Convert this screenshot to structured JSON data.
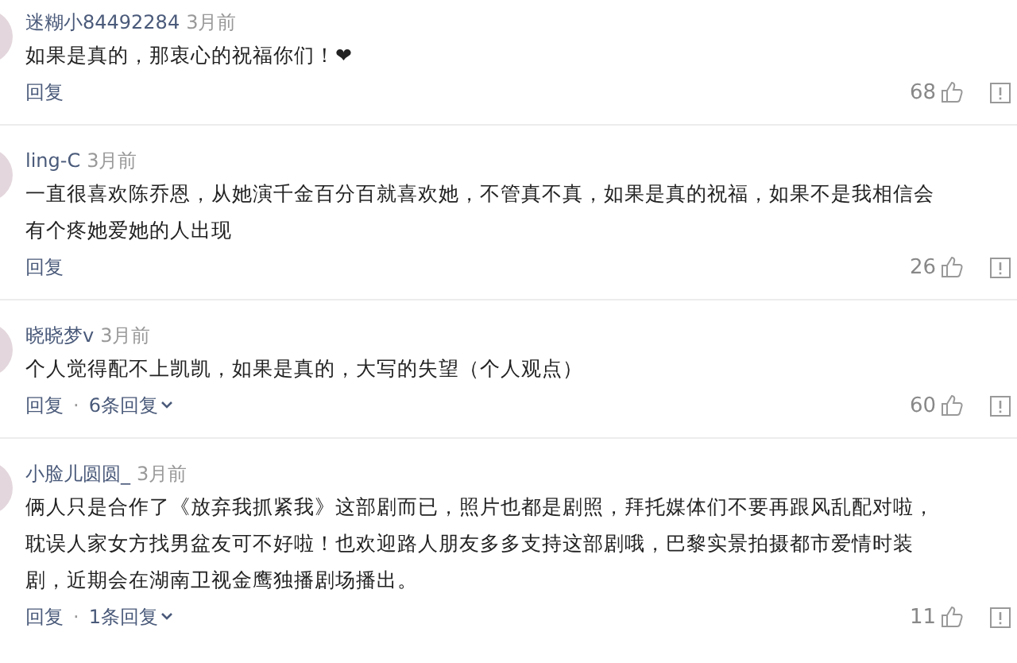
{
  "comments": [
    {
      "user": "迷糊小84492284",
      "time": "3月前",
      "lines": [
        "如果是真的，那衷心的祝福你们！❤"
      ],
      "reply": "回复",
      "likes": "68"
    },
    {
      "user": "ling-C",
      "time": "3月前",
      "lines": [
        "一直很喜欢陈乔恩，从她演千金百分百就喜欢她，不管真不真，如果是真的祝福，如果不是我相信会",
        "有个疼她爱她的人出现"
      ],
      "reply": "回复",
      "likes": "26"
    },
    {
      "user": "晓晓梦v",
      "time": "3月前",
      "lines": [
        "个人觉得配不上凯凯，如果是真的，大写的失望（个人观点）"
      ],
      "reply": "回复",
      "sep": "·",
      "more": "6条回复",
      "likes": "60"
    },
    {
      "user": "小脸儿圆圆_",
      "time": "3月前",
      "lines": [
        "俩人只是合作了《放弃我抓紧我》这部剧而已，照片也都是剧照，拜托媒体们不要再跟风乱配对啦，",
        "耽误人家女方找男盆友可不好啦！也欢迎路人朋友多多支持这部剧哦，巴黎实景拍摄都市爱情时装",
        "剧，近期会在湖南卫视金鹰独播剧场播出。"
      ],
      "reply": "回复",
      "sep": "·",
      "more": "1条回复",
      "likes": "11"
    }
  ]
}
